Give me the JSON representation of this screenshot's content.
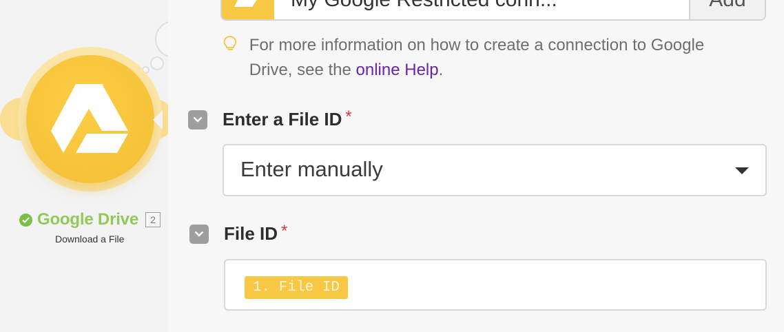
{
  "canvas": {
    "module": {
      "name": "Google Drive",
      "number": "2",
      "subtitle": "Download a File",
      "icon": "google-drive-icon",
      "status_icon": "check-circle-icon"
    },
    "colors": {
      "brand": "#f8c845",
      "status_ok": "#7dbe45",
      "module_name": "#93c85a"
    }
  },
  "panel": {
    "connection": {
      "value": "My Google Restricted conn...",
      "add_label": "Add"
    },
    "hint": {
      "text_before": "For more information on how to create a connection to Google Drive, see the ",
      "link": "online Help",
      "text_after": ".",
      "icon": "lightbulb-icon"
    },
    "file_id_mode": {
      "label": "Enter a File ID",
      "required_mark": "*",
      "value": "Enter manually"
    },
    "file_id": {
      "label": "File ID",
      "required_mark": "*",
      "token": "1. File ID"
    },
    "colors": {
      "link": "#6b22ad",
      "required": "#d93a3a"
    }
  }
}
